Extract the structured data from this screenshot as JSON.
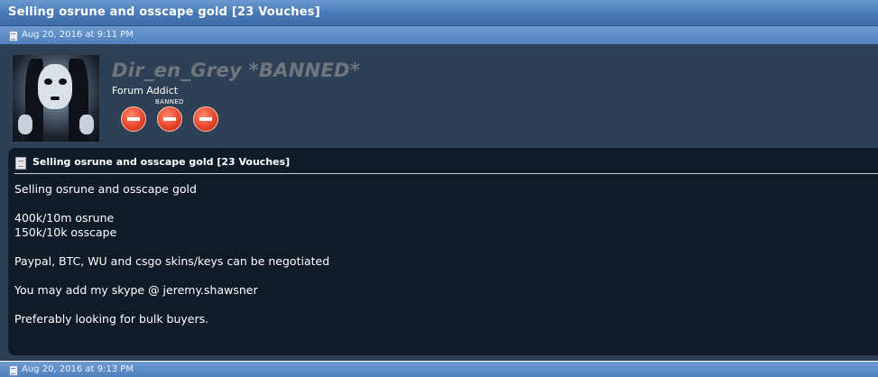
{
  "thread": {
    "title": "Selling osrune and osscape gold [23 Vouches]"
  },
  "post": {
    "date": "Aug 20, 2016 at 9:11 PM",
    "author": {
      "username": "Dir_en_Grey *BANNED*",
      "user_title": "Forum Addict",
      "reputation_label": "BANNED",
      "reputation_icon": "negative-rep-icon",
      "rep_color": "#e8452a"
    },
    "message": {
      "title": "Selling osrune and osscape gold [23 Vouches]",
      "lines": [
        "Selling osrune and osscape gold",
        "400k/10m osrune",
        "150k/10k osscape",
        "Paypal, BTC, WU and csgo skins/keys can be negotiated",
        "You may add my skype @ jeremy.shawsner",
        "Preferably looking for bulk buyers."
      ]
    }
  },
  "next_post": {
    "date": "Aug 20, 2016 at 9:13 PM"
  },
  "colors": {
    "header_blue": "#4a7bb8",
    "post_bg": "#2e4055",
    "message_bg": "#0f1b27",
    "username_gray": "#6f767e"
  }
}
